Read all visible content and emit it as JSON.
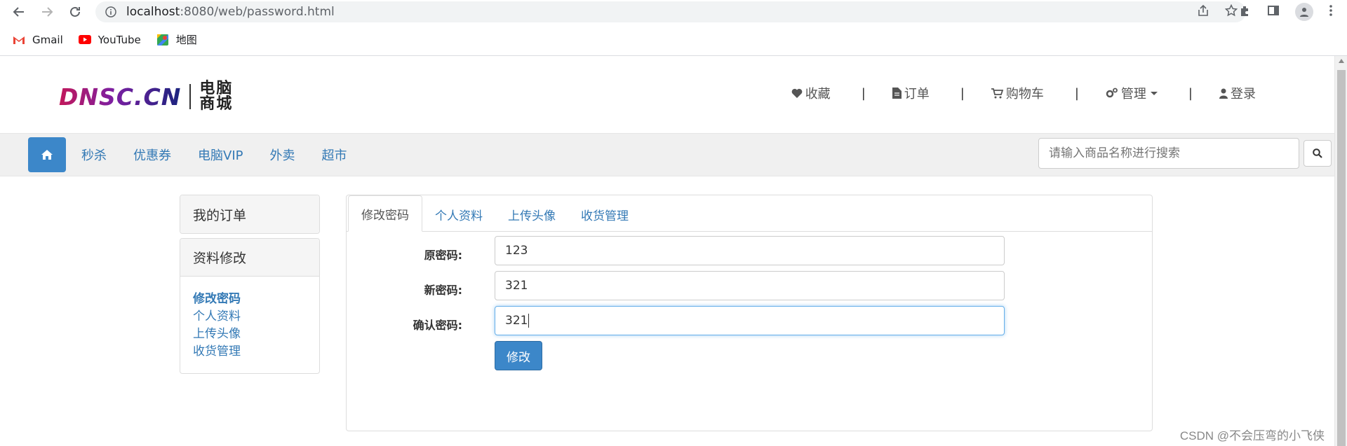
{
  "browser": {
    "url_host": "localhost",
    "url_path": ":8080/web/password.html",
    "bookmarks": [
      {
        "label": "Gmail",
        "icon": "gmail-icon"
      },
      {
        "label": "YouTube",
        "icon": "youtube-icon"
      },
      {
        "label": "地图",
        "icon": "maps-icon"
      }
    ]
  },
  "header": {
    "logo_text": "DNSC.CN",
    "logo_sub_line1": "电脑",
    "logo_sub_line2": "商城",
    "links": [
      {
        "label": "收藏",
        "icon": "heart-icon"
      },
      {
        "label": "订单",
        "icon": "file-icon"
      },
      {
        "label": "购物车",
        "icon": "cart-icon"
      },
      {
        "label": "管理",
        "icon": "gears-icon"
      },
      {
        "label": "登录",
        "icon": "user-icon"
      }
    ],
    "separator": "|"
  },
  "navbar": {
    "items": [
      "秒杀",
      "优惠券",
      "电脑VIP",
      "外卖",
      "超市"
    ],
    "search_placeholder": "请输入商品名称进行搜索"
  },
  "sidebar": {
    "orders_title": "我的订单",
    "profile_title": "资料修改",
    "links": [
      "修改密码",
      "个人资料",
      "上传头像",
      "收货管理"
    ]
  },
  "tabs": [
    "修改密码",
    "个人资料",
    "上传头像",
    "收货管理"
  ],
  "form": {
    "old_password_label": "原密码:",
    "old_password_value": "123",
    "new_password_label": "新密码:",
    "new_password_value": "321",
    "confirm_password_label": "确认密码:",
    "confirm_password_value": "321",
    "submit_label": "修改"
  },
  "watermark": "CSDN @不会压弯的小飞侠"
}
